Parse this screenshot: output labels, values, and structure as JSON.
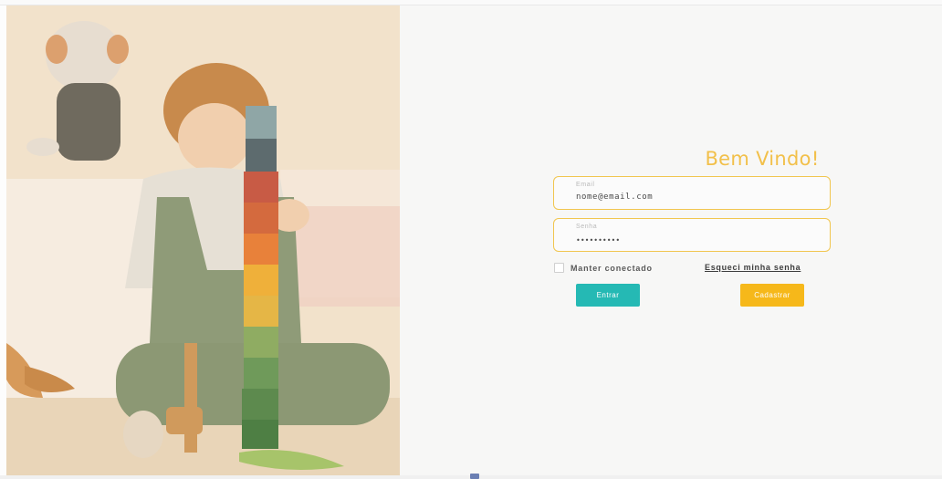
{
  "login": {
    "title": "Bem Vindo!",
    "email": {
      "label": "Email",
      "value": "nome@email.com"
    },
    "password": {
      "label": "Senha",
      "value": "••••••••••"
    },
    "remember_label": "Manter conectado",
    "forgot_label": "Esqueci minha senha",
    "enter_label": "Entrar",
    "register_label": "Cadastrar"
  },
  "colors": {
    "accent": "#f2c04a",
    "enter_button": "#25b9b4",
    "register_button": "#f6b81a"
  },
  "hero_image": "child-stacking-colored-blocks-photo"
}
